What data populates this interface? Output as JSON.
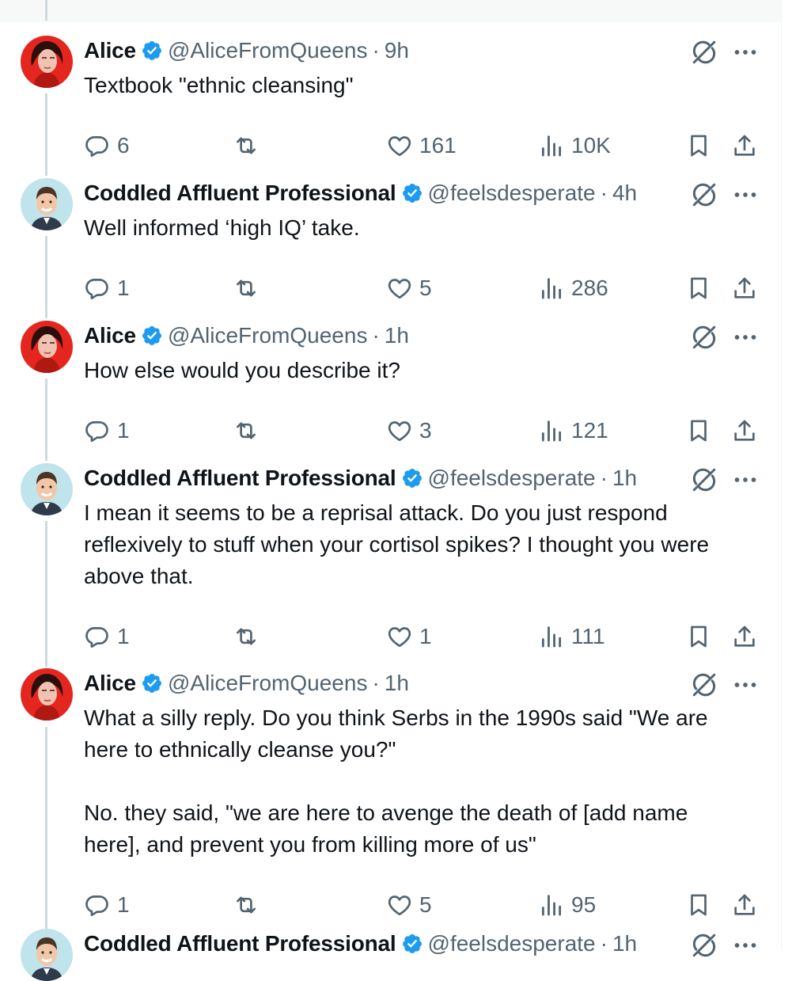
{
  "colors": {
    "verified": "#1d9bf0",
    "muted": "#536471",
    "thread_line": "#cfd9de"
  },
  "icons": [
    "reply-icon",
    "retweet-icon",
    "like-icon",
    "views-icon",
    "bookmark-icon",
    "share-icon",
    "grok-icon",
    "more-icon",
    "verified-badge-icon"
  ],
  "tweets": [
    {
      "name": "Alice",
      "handle": "@AliceFromQueens",
      "sep": "·",
      "time": "9h",
      "text": "Textbook \"ethnic cleansing\"",
      "replies": "6",
      "retweets": "",
      "likes": "161",
      "views": "10K"
    },
    {
      "name": "Coddled Affluent Professional",
      "handle": "@feelsdesperate",
      "sep": "·",
      "time": "4h",
      "text": "Well informed ‘high IQ’ take.",
      "replies": "1",
      "retweets": "",
      "likes": "5",
      "views": "286"
    },
    {
      "name": "Alice",
      "handle": "@AliceFromQueens",
      "sep": "·",
      "time": "1h",
      "text": "How else would you describe it?",
      "replies": "1",
      "retweets": "",
      "likes": "3",
      "views": "121"
    },
    {
      "name": "Coddled Affluent Professional",
      "handle": "@feelsdesperate",
      "sep": "·",
      "time": "1h",
      "text": "I mean it seems to be a reprisal attack. Do you just respond\nreflexively to stuff when your cortisol spikes? I thought you were\nabove that.",
      "replies": "1",
      "retweets": "",
      "likes": "1",
      "views": "111"
    },
    {
      "name": "Alice",
      "handle": "@AliceFromQueens",
      "sep": "·",
      "time": "1h",
      "text": "What a silly reply. Do you think Serbs in the 1990s said \"We are\nhere to ethnically cleanse you?\"\n\nNo. they said, \"we are here to avenge the death of [add name\nhere], and prevent you from killing more of us\"",
      "replies": "1",
      "retweets": "",
      "likes": "5",
      "views": "95"
    },
    {
      "name": "Coddled Affluent Professional",
      "handle": "@feelsdesperate",
      "sep": "·",
      "time": "1h",
      "text": "",
      "replies": "",
      "retweets": "",
      "likes": "",
      "views": ""
    }
  ]
}
